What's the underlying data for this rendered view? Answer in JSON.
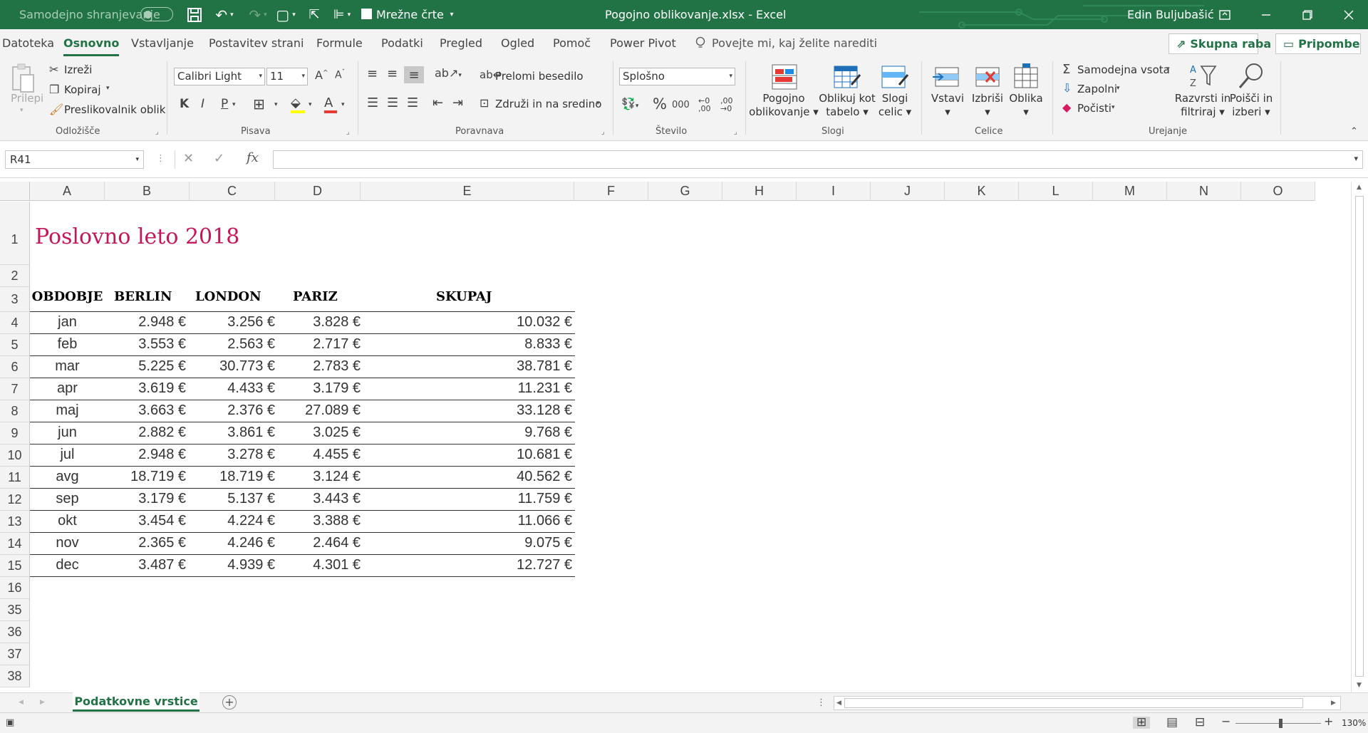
{
  "titlebar": {
    "autosave_label": "Samodejno shranjevanje",
    "gridlines_label": "Mrežne črte",
    "doc_title": "Pogojno oblikovanje.xlsx  -  Excel",
    "user": "Edin Buljubašić"
  },
  "menu": {
    "tabs": [
      "Datoteka",
      "Osnovno",
      "Vstavljanje",
      "Postavitev strani",
      "Formule",
      "Podatki",
      "Pregled",
      "Ogled",
      "Pomoč",
      "Power Pivot"
    ],
    "active_tab": "Osnovno",
    "tell_me": "Povejte mi, kaj želite narediti",
    "share": "Skupna raba",
    "comments": "Pripombe"
  },
  "ribbon": {
    "clipboard": {
      "paste": "Prilepi",
      "cut": "Izreži",
      "copy": "Kopiraj",
      "format_painter": "Preslikovalnik oblik",
      "label": "Odložišče"
    },
    "font": {
      "name": "Calibri Light",
      "size": "11",
      "bold": "K",
      "italic": "I",
      "underline": "P",
      "label": "Pisava"
    },
    "alignment": {
      "wrap": "Prelomi besedilo",
      "merge": "Združi in na sredino",
      "label": "Poravnava"
    },
    "number": {
      "format": "Splošno",
      "label": "Število"
    },
    "styles": {
      "conditional": [
        "Pogojno",
        "oblikovanje"
      ],
      "as_table": [
        "Oblikuj kot",
        "tabelo"
      ],
      "cell_styles": [
        "Slogi",
        "celic"
      ],
      "label": "Slogi"
    },
    "cells": {
      "insert": "Vstavi",
      "delete": "Izbriši",
      "format": "Oblika",
      "label": "Celice"
    },
    "editing": {
      "autosum": "Samodejna vsota",
      "fill": "Zapolni",
      "clear": "Počisti",
      "sort": [
        "Razvrsti in",
        "filtriraj"
      ],
      "find": [
        "Poišči in",
        "izberi"
      ],
      "label": "Urejanje"
    }
  },
  "formula_bar": {
    "name_box": "R41",
    "formula": ""
  },
  "columns": [
    "A",
    "B",
    "C",
    "D",
    "E",
    "F",
    "G",
    "H",
    "I",
    "J",
    "K",
    "L",
    "M",
    "N",
    "O"
  ],
  "rows": [
    "1",
    "2",
    "3",
    "4",
    "5",
    "6",
    "7",
    "8",
    "9",
    "10",
    "11",
    "12",
    "13",
    "14",
    "15",
    "16",
    "35",
    "36",
    "37",
    "38"
  ],
  "sheet": {
    "title": "Poslovno leto 2018",
    "headers": [
      "OBDOBJE",
      "BERLIN",
      "LONDON",
      "PARIZ",
      "SKUPAJ"
    ],
    "data": [
      [
        "jan",
        "2.948 €",
        "3.256 €",
        "3.828 €",
        "10.032 €"
      ],
      [
        "feb",
        "3.553 €",
        "2.563 €",
        "2.717 €",
        "8.833 €"
      ],
      [
        "mar",
        "5.225 €",
        "30.773 €",
        "2.783 €",
        "38.781 €"
      ],
      [
        "apr",
        "3.619 €",
        "4.433 €",
        "3.179 €",
        "11.231 €"
      ],
      [
        "maj",
        "3.663 €",
        "2.376 €",
        "27.089 €",
        "33.128 €"
      ],
      [
        "jun",
        "2.882 €",
        "3.861 €",
        "3.025 €",
        "9.768 €"
      ],
      [
        "jul",
        "2.948 €",
        "3.278 €",
        "4.455 €",
        "10.681 €"
      ],
      [
        "avg",
        "18.719 €",
        "18.719 €",
        "3.124 €",
        "40.562 €"
      ],
      [
        "sep",
        "3.179 €",
        "5.137 €",
        "3.443 €",
        "11.759 €"
      ],
      [
        "okt",
        "3.454 €",
        "4.224 €",
        "3.388 €",
        "11.066 €"
      ],
      [
        "nov",
        "2.365 €",
        "4.246 €",
        "2.464 €",
        "9.075 €"
      ],
      [
        "dec",
        "3.487 €",
        "4.939 €",
        "4.301 €",
        "12.727 €"
      ]
    ]
  },
  "sheet_tabs": {
    "active": "Podatkovne vrstice"
  },
  "status": {
    "zoom": "130%"
  },
  "colors": {
    "excel_green": "#217346",
    "title_pink": "#c2185b"
  }
}
